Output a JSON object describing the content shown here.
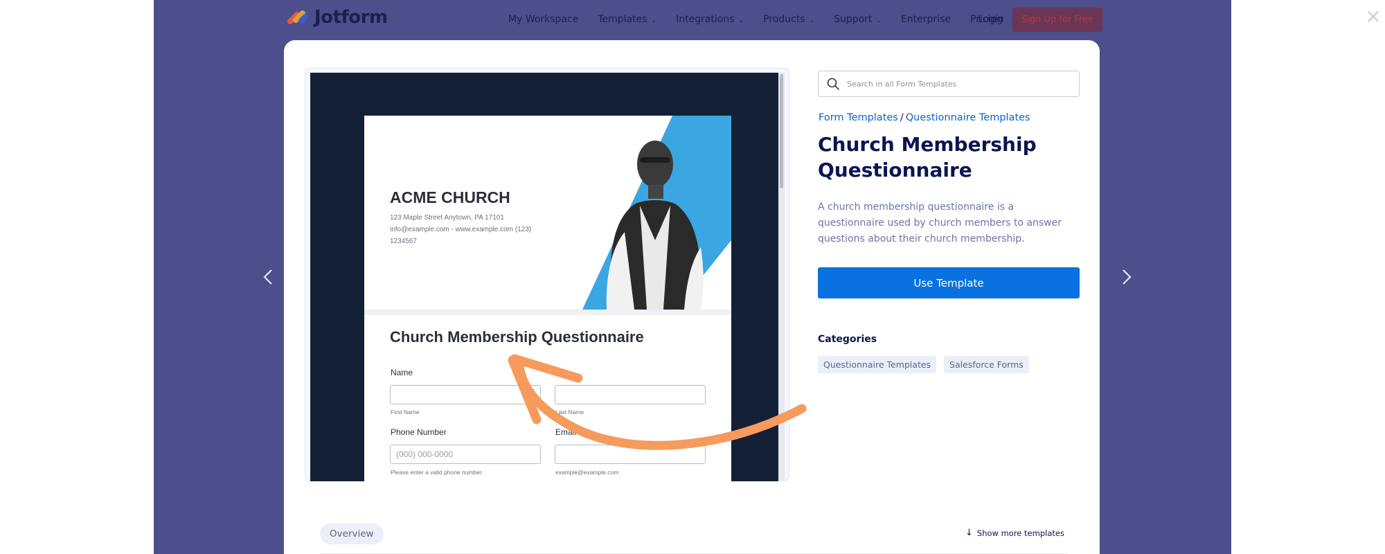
{
  "nav": {
    "brand": "Jotform",
    "links": [
      {
        "label": "My Workspace",
        "caret": ""
      },
      {
        "label": "Templates",
        "caret": "⌄"
      },
      {
        "label": "Integrations",
        "caret": "⌄"
      },
      {
        "label": "Products",
        "caret": "⌄"
      },
      {
        "label": "Support",
        "caret": "⌄"
      },
      {
        "label": "Enterprise",
        "caret": ""
      },
      {
        "label": "Pricing",
        "caret": ""
      }
    ],
    "login": "Login",
    "signup": "Sign Up for Free"
  },
  "overlay": {
    "close_glyph": "✕"
  },
  "preview": {
    "church_name": "ACME CHURCH",
    "address_lines": [
      "123 Maple Street Anytown, PA 17101",
      "info@example.com - www.example.com (123)",
      "1234567"
    ],
    "form_title": "Church Membership Questionnaire",
    "name_label": "Name",
    "first_name_sub": "First Name",
    "last_name_sub": "Last Name",
    "phone_label": "Phone Number",
    "phone_placeholder": "(000) 000-0000",
    "phone_sub": "Please enter a valid phone number.",
    "email_label": "Email",
    "email_sub": "example@example.com"
  },
  "sidebar": {
    "search_placeholder": "Search in all Form Templates",
    "breadcrumb": {
      "root": "Form Templates",
      "sep": "/",
      "current": "Questionnaire Templates"
    },
    "title": "Church Membership Questionnaire",
    "description": "A church membership questionnaire is a questionnaire used by church members to answer questions about their church membership.",
    "use_button": "Use Template",
    "categories_heading": "Categories",
    "categories": [
      "Questionnaire Templates",
      "Salesforce Forms"
    ]
  },
  "footer": {
    "overview_tab": "Overview",
    "more_templates": "Show more templates",
    "more_arrow": "↓"
  },
  "colors": {
    "backdrop": "#4c4f8c",
    "accent": "#0a72e0",
    "title": "#0a1551",
    "annotation_arrow": "#f79a5d"
  }
}
